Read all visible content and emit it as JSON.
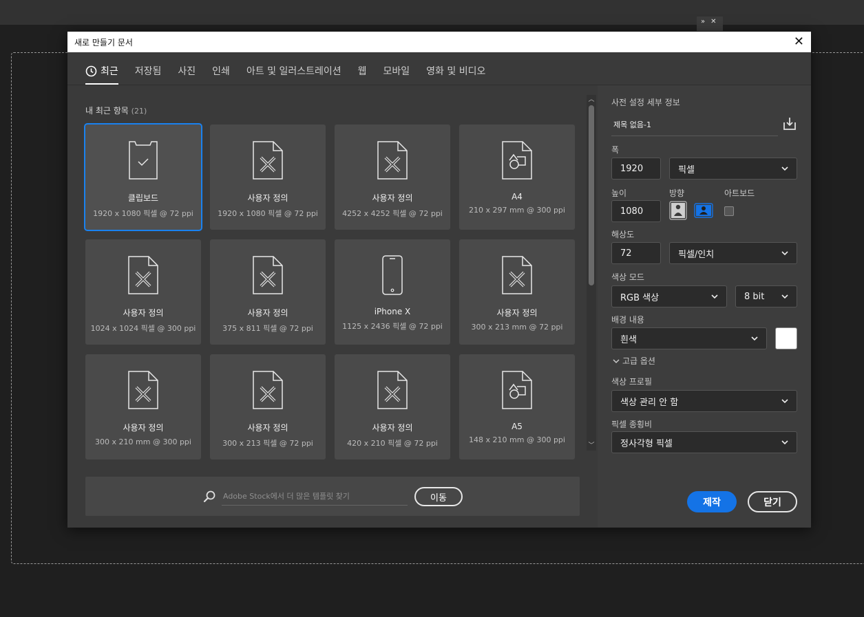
{
  "dialog": {
    "title": "새로 만들기 문서"
  },
  "tabs": [
    {
      "label": "최근"
    },
    {
      "label": "저장됨"
    },
    {
      "label": "사진"
    },
    {
      "label": "인쇄"
    },
    {
      "label": "아트 및 일러스트레이션"
    },
    {
      "label": "웹"
    },
    {
      "label": "모바일"
    },
    {
      "label": "영화 및 비디오"
    }
  ],
  "recent": {
    "title": "내 최근 항목",
    "count": "(21)",
    "items": [
      {
        "name": "클립보드",
        "spec": "1920 x 1080 픽셀 @ 72 ppi",
        "icon": "clipboard-icon"
      },
      {
        "name": "사용자 정의",
        "spec": "1920 x 1080 픽셀 @ 72 ppi",
        "icon": "custom-document-icon"
      },
      {
        "name": "사용자 정의",
        "spec": "4252 x 4252 픽셀 @ 72 ppi",
        "icon": "custom-document-icon"
      },
      {
        "name": "A4",
        "spec": "210 x 297 mm @ 300 ppi",
        "icon": "print-document-icon"
      },
      {
        "name": "사용자 정의",
        "spec": "1024 x 1024 픽셀 @ 300 ppi",
        "icon": "custom-document-icon"
      },
      {
        "name": "사용자 정의",
        "spec": "375 x 811 픽셀 @ 72 ppi",
        "icon": "custom-document-icon"
      },
      {
        "name": "iPhone X",
        "spec": "1125 x 2436 픽셀 @ 72 ppi",
        "icon": "phone-icon"
      },
      {
        "name": "사용자 정의",
        "spec": "300 x 213 mm @ 72 ppi",
        "icon": "custom-document-icon"
      },
      {
        "name": "사용자 정의",
        "spec": "300 x 210 mm @ 300 ppi",
        "icon": "custom-document-icon"
      },
      {
        "name": "사용자 정의",
        "spec": "300 x 213 픽셀 @ 72 ppi",
        "icon": "custom-document-icon"
      },
      {
        "name": "사용자 정의",
        "spec": "420 x 210 픽셀 @ 72 ppi",
        "icon": "custom-document-icon"
      },
      {
        "name": "A5",
        "spec": "148 x 210 mm @ 300 ppi",
        "icon": "print-document-icon"
      }
    ]
  },
  "stock": {
    "placeholder": "Adobe Stock에서 더 많은 템플릿 찾기",
    "go_label": "이동"
  },
  "preset": {
    "section_title": "사전 설정 세부 정보",
    "doc_name": "제목 없음-1",
    "width_label": "폭",
    "width_value": "1920",
    "width_unit": "픽셀",
    "height_label": "높이",
    "height_value": "1080",
    "orientation_label": "방향",
    "artboard_label": "아트보드",
    "resolution_label": "해상도",
    "resolution_value": "72",
    "resolution_unit": "픽셀/인치",
    "color_mode_label": "색상 모드",
    "color_mode_value": "RGB 색상",
    "bit_depth_value": "8 bit",
    "background_label": "배경 내용",
    "background_value": "흰색",
    "background_color": "#ffffff",
    "advanced_label": "고급 옵션",
    "color_profile_label": "색상 프로필",
    "color_profile_value": "색상 관리 안 함",
    "pixel_aspect_label": "픽셀 종횡비",
    "pixel_aspect_value": "정사각형 픽셀"
  },
  "buttons": {
    "create_label": "제작",
    "close_label": "닫기"
  },
  "colors": {
    "accent": "#1473e6",
    "selection": "#1a82f0"
  }
}
